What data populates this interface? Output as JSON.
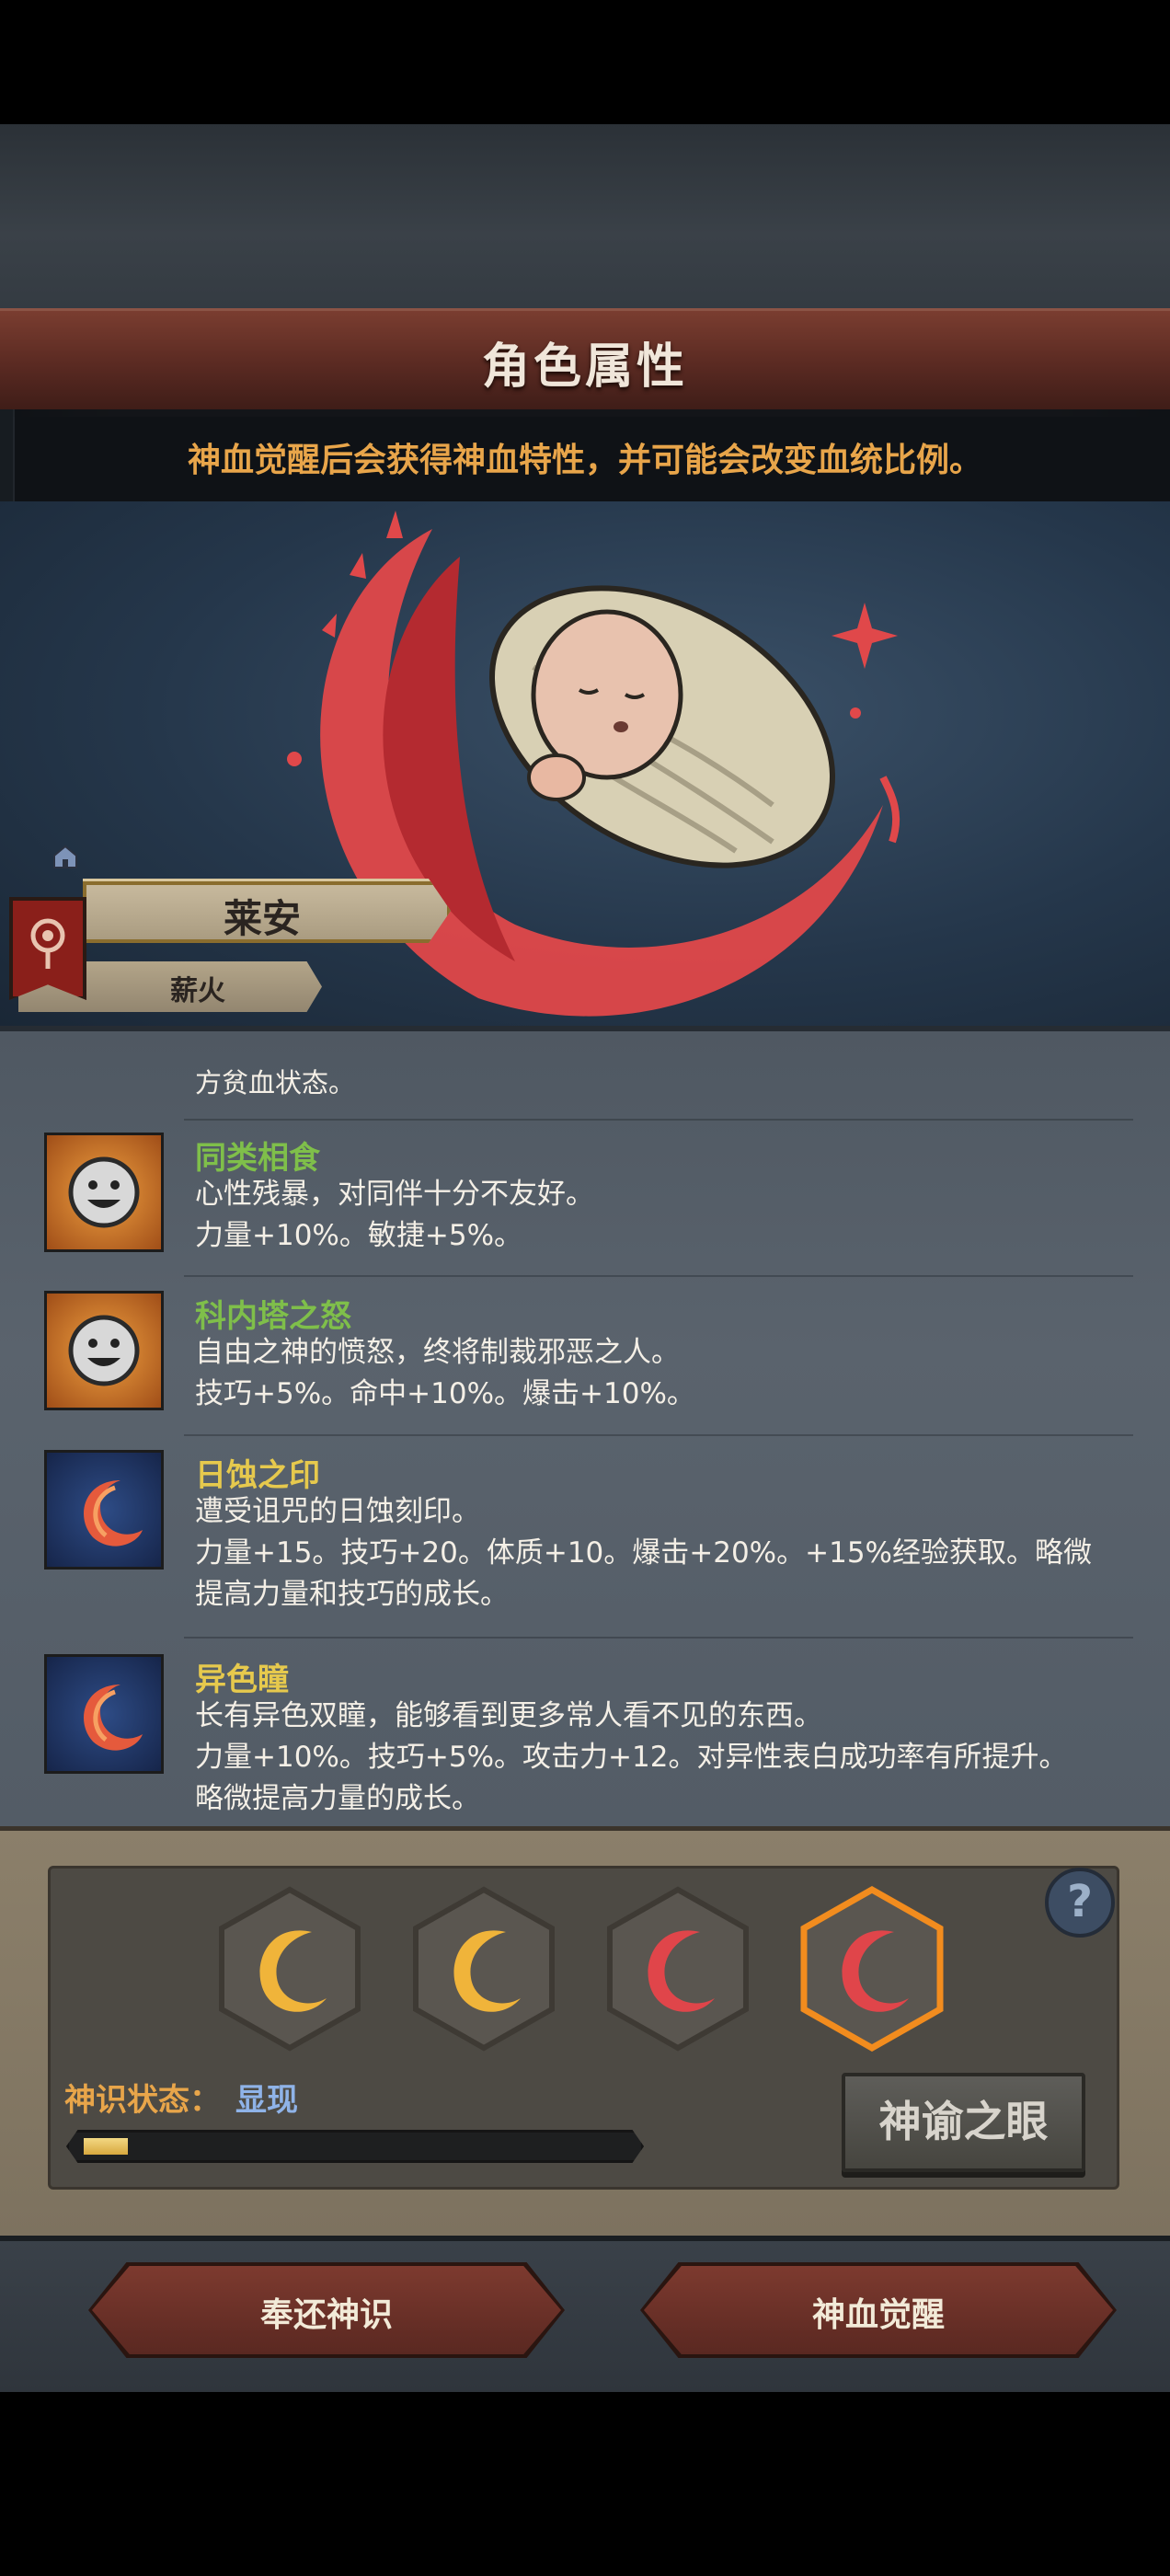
{
  "header": {
    "title": "角色属性"
  },
  "subtitle": "神血觉醒后会获得神血特性，并可能会改变血统比例。",
  "character": {
    "name": "莱安",
    "tag": "薪火"
  },
  "traits_cut": {
    "desc": "方贫血状态。"
  },
  "traits": [
    {
      "name": "同类相食",
      "name_color": "#7fbf4a",
      "icon": "grinning-sun-icon",
      "line1": "心性残暴，对同伴十分不友好。",
      "line2": "力量+10%。敏捷+5%。",
      "line3": ""
    },
    {
      "name": "科内塔之怒",
      "name_color": "#7fbf4a",
      "icon": "grinning-sun-icon",
      "line1": "自由之神的愤怒，终将制裁邪恶之人。",
      "line2": "技巧+5%。命中+10%。爆击+10%。",
      "line3": ""
    },
    {
      "name": "日蚀之印",
      "name_color": "#e6c94d",
      "icon": "crescent-moon-icon",
      "line1": "遭受诅咒的日蚀刻印。",
      "line2": "力量+15。技巧+20。体质+10。爆击+20%。+15%经验获取。略微",
      "line3": "提高力量和技巧的成长。"
    },
    {
      "name": "异色瞳",
      "name_color": "#e6c94d",
      "icon": "crescent-moon-icon",
      "line1": "长有异色双瞳，能够看到更多常人看不见的东西。",
      "line2": "力量+10%。技巧+5%。攻击力+12。对异性表白成功率有所提升。",
      "line3": "略微提高力量的成长。"
    }
  ],
  "sense": {
    "status_label": "神识状态：",
    "status_value": "显现",
    "progress": 0.08,
    "eye_button": "神谕之眼",
    "help": "?",
    "slots": [
      {
        "icon": "gold-crescent-icon",
        "color": "#f0b43a"
      },
      {
        "icon": "gold-crescent-icon",
        "color": "#f0b43a"
      },
      {
        "icon": "red-crescent-icon",
        "color": "#e0454a"
      },
      {
        "icon": "red-crescent-icon",
        "color": "#e0454a",
        "selected": true
      }
    ]
  },
  "footer": {
    "left_button": "奉还神识",
    "right_button": "神血觉醒"
  }
}
